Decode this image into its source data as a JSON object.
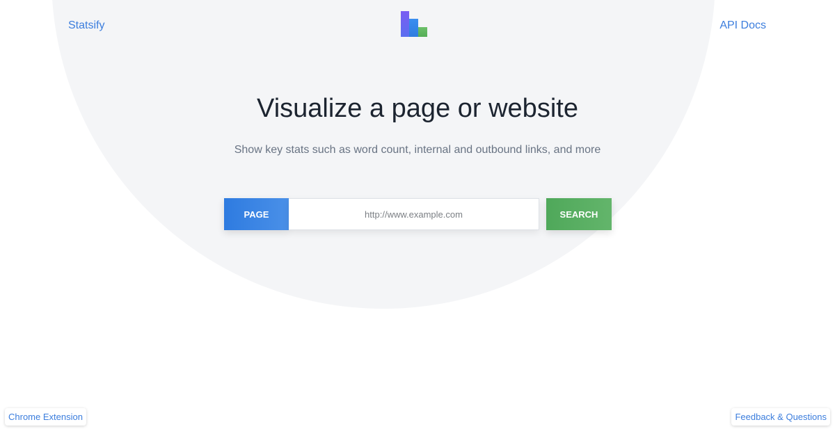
{
  "header": {
    "brand": "Statsify",
    "api_docs": "API Docs",
    "logo_icon": "bar-chart-logo-icon",
    "logo_colors": [
      "#7b5cf0",
      "#3d86ee",
      "#5cb85c"
    ]
  },
  "hero": {
    "title": "Visualize a page or website",
    "subtitle": "Show key stats such as word count, internal and outbound links, and more"
  },
  "search": {
    "mode_label": "PAGE",
    "placeholder": "http://www.example.com",
    "value": "",
    "submit_label": "SEARCH"
  },
  "footer": {
    "chrome_extension": "Chrome Extension",
    "feedback": "Feedback & Questions"
  },
  "colors": {
    "accent_blue": "#3b7ddd",
    "search_green": "#5cb85c",
    "background_circle": "#f4f5f7"
  }
}
